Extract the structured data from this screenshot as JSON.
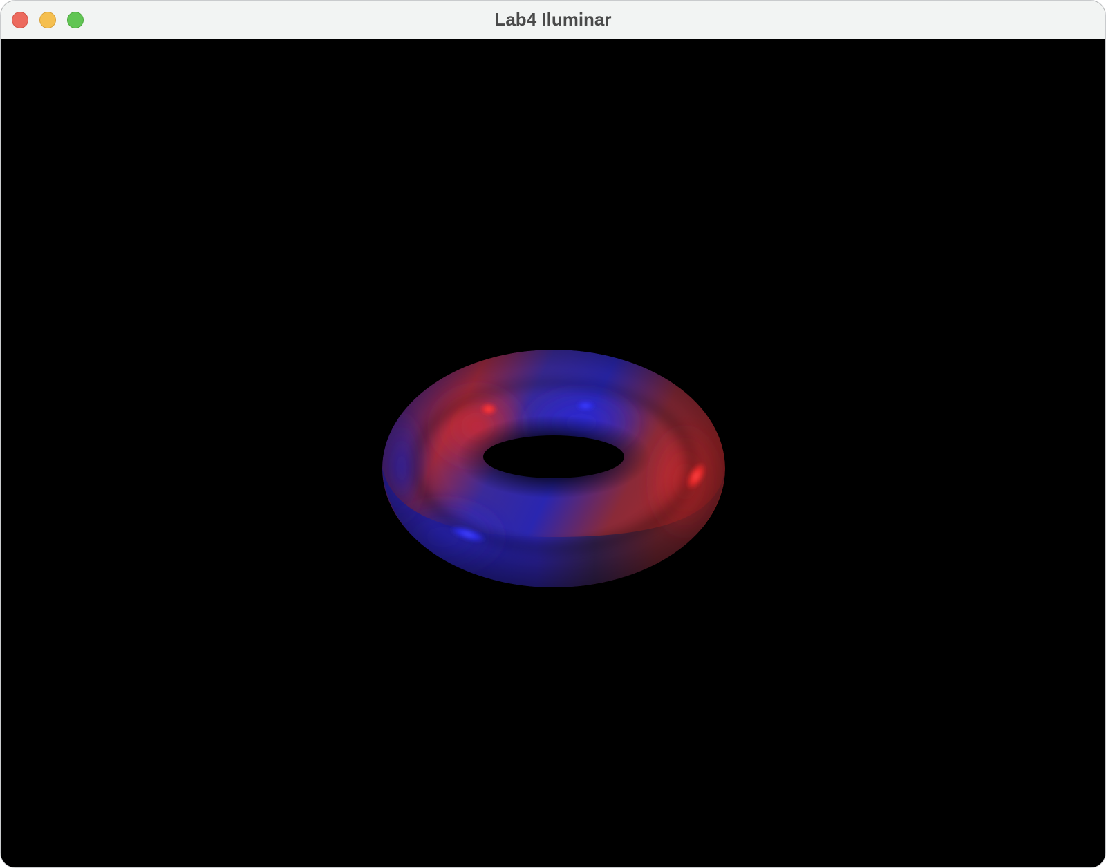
{
  "window": {
    "title": "Lab4 Iluminar"
  },
  "scene": {
    "object": "torus",
    "background_color": "#000000",
    "colors": {
      "red": "#c0282b",
      "blue": "#2a24c6",
      "highlight_red": "#ff3a3a",
      "highlight_blue": "#3a3aff"
    }
  }
}
